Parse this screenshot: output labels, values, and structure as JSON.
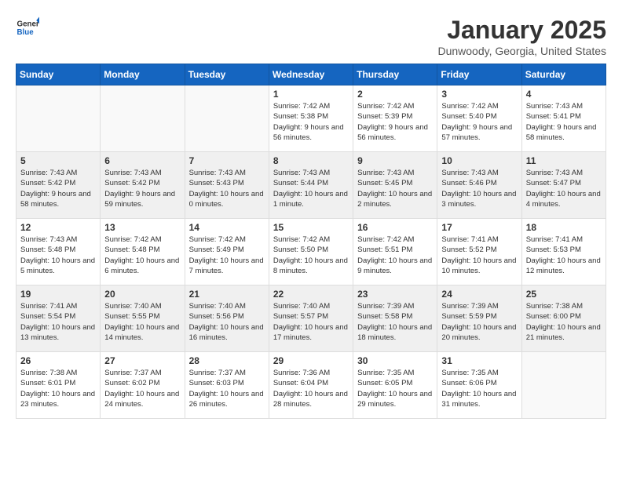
{
  "header": {
    "logo_general": "General",
    "logo_blue": "Blue",
    "title": "January 2025",
    "subtitle": "Dunwoody, Georgia, United States"
  },
  "weekdays": [
    "Sunday",
    "Monday",
    "Tuesday",
    "Wednesday",
    "Thursday",
    "Friday",
    "Saturday"
  ],
  "weeks": [
    [
      {
        "day": "",
        "info": ""
      },
      {
        "day": "",
        "info": ""
      },
      {
        "day": "",
        "info": ""
      },
      {
        "day": "1",
        "info": "Sunrise: 7:42 AM\nSunset: 5:38 PM\nDaylight: 9 hours and 56 minutes."
      },
      {
        "day": "2",
        "info": "Sunrise: 7:42 AM\nSunset: 5:39 PM\nDaylight: 9 hours and 56 minutes."
      },
      {
        "day": "3",
        "info": "Sunrise: 7:42 AM\nSunset: 5:40 PM\nDaylight: 9 hours and 57 minutes."
      },
      {
        "day": "4",
        "info": "Sunrise: 7:43 AM\nSunset: 5:41 PM\nDaylight: 9 hours and 58 minutes."
      }
    ],
    [
      {
        "day": "5",
        "info": "Sunrise: 7:43 AM\nSunset: 5:42 PM\nDaylight: 9 hours and 58 minutes."
      },
      {
        "day": "6",
        "info": "Sunrise: 7:43 AM\nSunset: 5:42 PM\nDaylight: 9 hours and 59 minutes."
      },
      {
        "day": "7",
        "info": "Sunrise: 7:43 AM\nSunset: 5:43 PM\nDaylight: 10 hours and 0 minutes."
      },
      {
        "day": "8",
        "info": "Sunrise: 7:43 AM\nSunset: 5:44 PM\nDaylight: 10 hours and 1 minute."
      },
      {
        "day": "9",
        "info": "Sunrise: 7:43 AM\nSunset: 5:45 PM\nDaylight: 10 hours and 2 minutes."
      },
      {
        "day": "10",
        "info": "Sunrise: 7:43 AM\nSunset: 5:46 PM\nDaylight: 10 hours and 3 minutes."
      },
      {
        "day": "11",
        "info": "Sunrise: 7:43 AM\nSunset: 5:47 PM\nDaylight: 10 hours and 4 minutes."
      }
    ],
    [
      {
        "day": "12",
        "info": "Sunrise: 7:43 AM\nSunset: 5:48 PM\nDaylight: 10 hours and 5 minutes."
      },
      {
        "day": "13",
        "info": "Sunrise: 7:42 AM\nSunset: 5:48 PM\nDaylight: 10 hours and 6 minutes."
      },
      {
        "day": "14",
        "info": "Sunrise: 7:42 AM\nSunset: 5:49 PM\nDaylight: 10 hours and 7 minutes."
      },
      {
        "day": "15",
        "info": "Sunrise: 7:42 AM\nSunset: 5:50 PM\nDaylight: 10 hours and 8 minutes."
      },
      {
        "day": "16",
        "info": "Sunrise: 7:42 AM\nSunset: 5:51 PM\nDaylight: 10 hours and 9 minutes."
      },
      {
        "day": "17",
        "info": "Sunrise: 7:41 AM\nSunset: 5:52 PM\nDaylight: 10 hours and 10 minutes."
      },
      {
        "day": "18",
        "info": "Sunrise: 7:41 AM\nSunset: 5:53 PM\nDaylight: 10 hours and 12 minutes."
      }
    ],
    [
      {
        "day": "19",
        "info": "Sunrise: 7:41 AM\nSunset: 5:54 PM\nDaylight: 10 hours and 13 minutes."
      },
      {
        "day": "20",
        "info": "Sunrise: 7:40 AM\nSunset: 5:55 PM\nDaylight: 10 hours and 14 minutes."
      },
      {
        "day": "21",
        "info": "Sunrise: 7:40 AM\nSunset: 5:56 PM\nDaylight: 10 hours and 16 minutes."
      },
      {
        "day": "22",
        "info": "Sunrise: 7:40 AM\nSunset: 5:57 PM\nDaylight: 10 hours and 17 minutes."
      },
      {
        "day": "23",
        "info": "Sunrise: 7:39 AM\nSunset: 5:58 PM\nDaylight: 10 hours and 18 minutes."
      },
      {
        "day": "24",
        "info": "Sunrise: 7:39 AM\nSunset: 5:59 PM\nDaylight: 10 hours and 20 minutes."
      },
      {
        "day": "25",
        "info": "Sunrise: 7:38 AM\nSunset: 6:00 PM\nDaylight: 10 hours and 21 minutes."
      }
    ],
    [
      {
        "day": "26",
        "info": "Sunrise: 7:38 AM\nSunset: 6:01 PM\nDaylight: 10 hours and 23 minutes."
      },
      {
        "day": "27",
        "info": "Sunrise: 7:37 AM\nSunset: 6:02 PM\nDaylight: 10 hours and 24 minutes."
      },
      {
        "day": "28",
        "info": "Sunrise: 7:37 AM\nSunset: 6:03 PM\nDaylight: 10 hours and 26 minutes."
      },
      {
        "day": "29",
        "info": "Sunrise: 7:36 AM\nSunset: 6:04 PM\nDaylight: 10 hours and 28 minutes."
      },
      {
        "day": "30",
        "info": "Sunrise: 7:35 AM\nSunset: 6:05 PM\nDaylight: 10 hours and 29 minutes."
      },
      {
        "day": "31",
        "info": "Sunrise: 7:35 AM\nSunset: 6:06 PM\nDaylight: 10 hours and 31 minutes."
      },
      {
        "day": "",
        "info": ""
      }
    ]
  ]
}
